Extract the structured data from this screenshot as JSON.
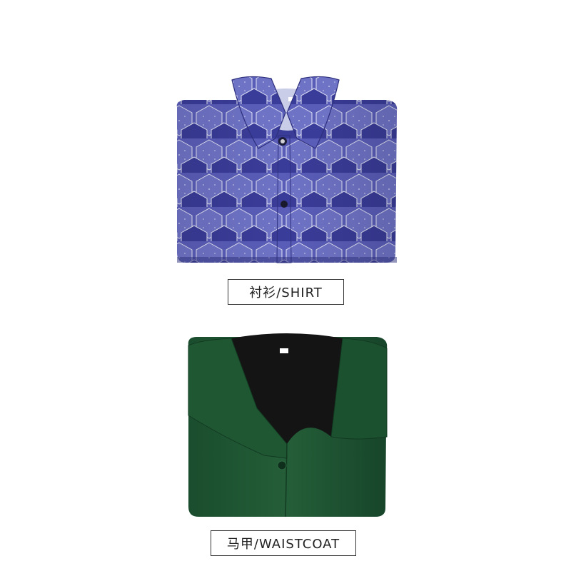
{
  "items": [
    {
      "label": "衬衫/SHIRT",
      "photo": "blue-hexagon-print-shirt-folded",
      "colors": {
        "main": "#4a4fa3",
        "dark_hex": "#2f318a",
        "collar": "#6a6fc0"
      }
    },
    {
      "label": "马甲/WAISTCOAT",
      "photo": "green-waistcoat-folded",
      "colors": {
        "main": "#1f5a35",
        "dark": "#143f24",
        "lining": "#151515"
      }
    }
  ]
}
